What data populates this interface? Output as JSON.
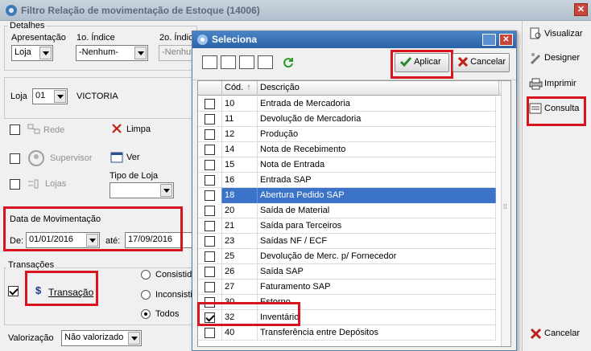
{
  "main": {
    "title": "Filtro Relação de movimentação de Estoque (14006)",
    "close_label": "✕"
  },
  "detalhes": {
    "legend": "Detalhes",
    "apresentacao_label": "Apresentação",
    "apresentacao_value": "Loja",
    "indice1_label": "1o. Índice",
    "indice1_value": "-Nenhum-",
    "indice2_label": "2o. Índic",
    "indice2_value": "-Nenhum"
  },
  "loja": {
    "label": "Loja",
    "value": "01",
    "name": "VICTORIA"
  },
  "filters": {
    "rede": "Rede",
    "limpa": "Limpa",
    "supervisor": "Supervisor",
    "ver": "Ver",
    "lojas": "Lojas",
    "tipo_loja_label": "Tipo de Loja",
    "tipo_loja_value": ""
  },
  "data_mov": {
    "label": "Data de Movimentação",
    "de_label": "De:",
    "de_value": "01/01/2016",
    "ate_label": "até:",
    "ate_value": "17/09/2016"
  },
  "transacoes": {
    "legend": "Transações",
    "transacao_label": "Transação",
    "consistida": "Consistida",
    "inconsistida": "Inconsisti",
    "todos": "Todos"
  },
  "valorizacao": {
    "label": "Valorização",
    "value": "Não valorizado"
  },
  "right_panel": {
    "visualizar": "Visualizar",
    "designer": "Designer",
    "imprimir": "Imprimir",
    "consulta": "Consulta",
    "cancelar": "Cancelar"
  },
  "popup": {
    "title": "Seleciona",
    "aplicar": "Aplicar",
    "cancelar": "Cancelar",
    "columns": {
      "cod": "Cód.",
      "descricao": "Descrição"
    },
    "rows": [
      {
        "cod": "10",
        "desc": "Entrada de Mercadoria",
        "checked": false,
        "selected": false
      },
      {
        "cod": "11",
        "desc": "Devolução de Mercadoria",
        "checked": false,
        "selected": false
      },
      {
        "cod": "12",
        "desc": "Produção",
        "checked": false,
        "selected": false
      },
      {
        "cod": "14",
        "desc": "Nota de Recebimento",
        "checked": false,
        "selected": false
      },
      {
        "cod": "15",
        "desc": "Nota de Entrada",
        "checked": false,
        "selected": false
      },
      {
        "cod": "16",
        "desc": "Entrada SAP",
        "checked": false,
        "selected": false
      },
      {
        "cod": "18",
        "desc": "Abertura Pedido SAP",
        "checked": false,
        "selected": true
      },
      {
        "cod": "20",
        "desc": "Saída de Material",
        "checked": false,
        "selected": false
      },
      {
        "cod": "21",
        "desc": "Saída para Terceiros",
        "checked": false,
        "selected": false
      },
      {
        "cod": "23",
        "desc": "Saídas NF / ECF",
        "checked": false,
        "selected": false
      },
      {
        "cod": "25",
        "desc": "Devolução de Merc. p/ Fornecedor",
        "checked": false,
        "selected": false
      },
      {
        "cod": "26",
        "desc": "Saída SAP",
        "checked": false,
        "selected": false
      },
      {
        "cod": "27",
        "desc": "Faturamento SAP",
        "checked": false,
        "selected": false
      },
      {
        "cod": "30",
        "desc": "Estorno",
        "checked": false,
        "selected": false
      },
      {
        "cod": "32",
        "desc": "Inventário",
        "checked": true,
        "selected": false
      },
      {
        "cod": "40",
        "desc": "Transferência entre Depósitos",
        "checked": false,
        "selected": false
      }
    ]
  }
}
